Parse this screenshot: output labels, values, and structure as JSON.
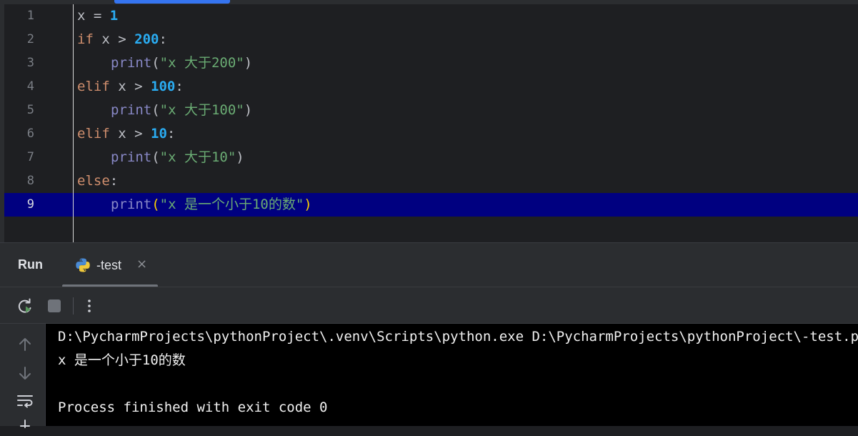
{
  "editor": {
    "lines": [
      {
        "n": "1"
      },
      {
        "n": "2"
      },
      {
        "n": "3",
        "str": "\"x 大于200\""
      },
      {
        "n": "4"
      },
      {
        "n": "5",
        "str": "\"x 大于100\""
      },
      {
        "n": "6"
      },
      {
        "n": "7",
        "str": "\"x 大于10\""
      },
      {
        "n": "8"
      },
      {
        "n": "9",
        "str": "\"x 是一个小于10的数\""
      }
    ],
    "tokens": {
      "x": "x",
      "eq": " = ",
      "gt": " > ",
      "colon": ":",
      "if": "if",
      "elif": "elif",
      "else": "else",
      "print": "print",
      "lparen": "(",
      "rparen": ")",
      "one": "1",
      "n200": "200",
      "n100": "100",
      "n10": "10"
    }
  },
  "run_panel": {
    "title": "Run",
    "tab_label": "-test",
    "close_glyph": "×"
  },
  "console": {
    "line1": "D:\\PycharmProjects\\pythonProject\\.venv\\Scripts\\python.exe D:\\PycharmProjects\\pythonProject\\-test.py",
    "line2": "x 是一个小于10的数",
    "line4": "Process finished with exit code 0"
  },
  "colors": {
    "editor_bg": "#1e1f22",
    "current_line": "#000080",
    "keyword": "#cf8e6d",
    "number": "#2aacf2",
    "builtin": "#8888c6",
    "string": "#6aab73",
    "console_bg": "#000000"
  }
}
